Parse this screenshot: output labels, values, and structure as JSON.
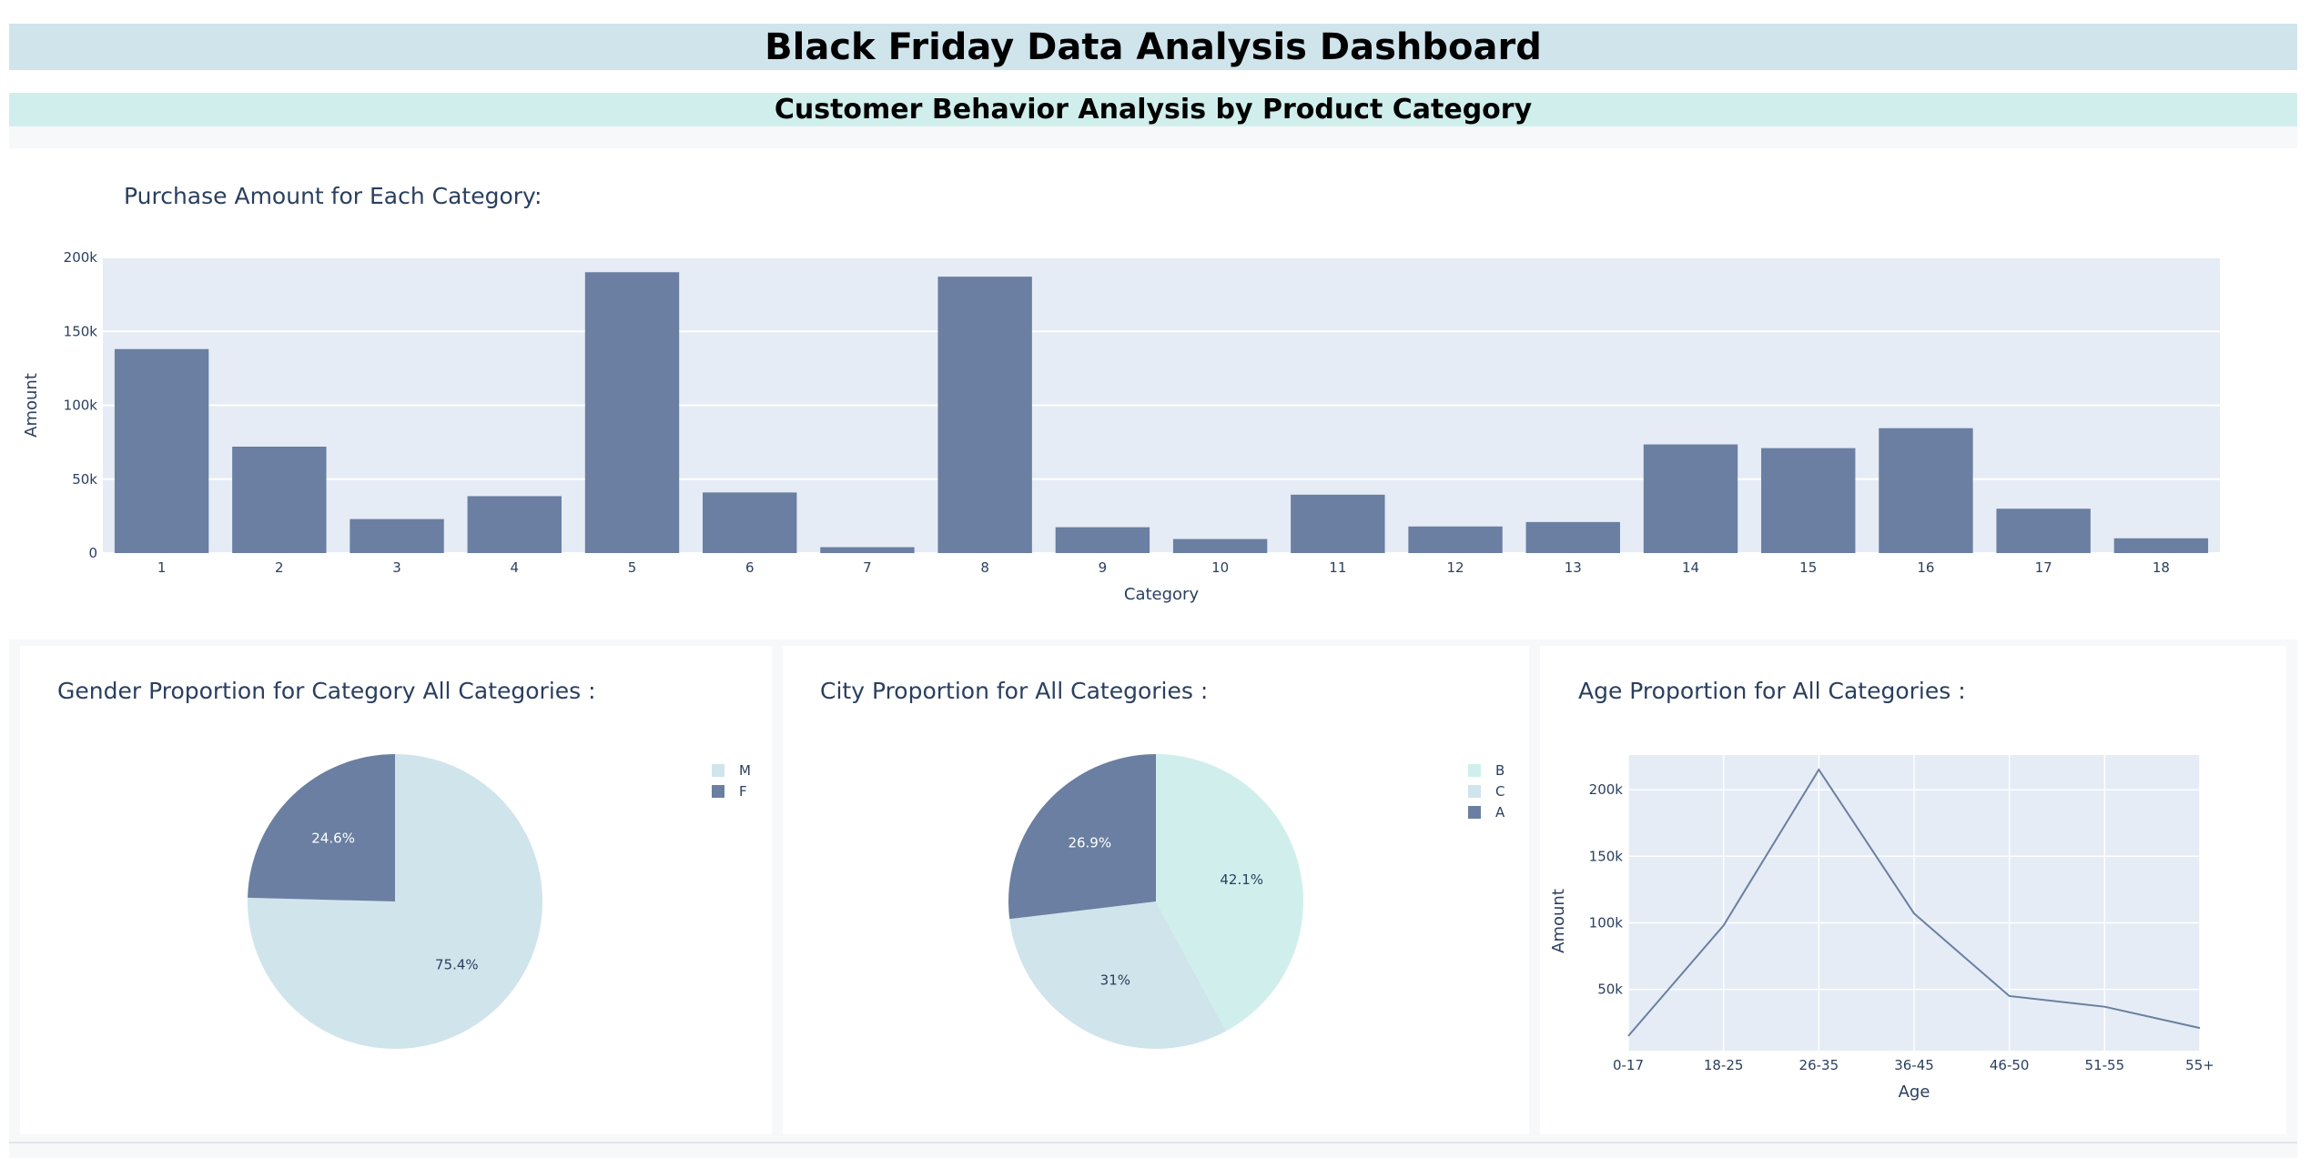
{
  "header": {
    "title": "Black Friday Data Analysis Dashboard",
    "subtitle": "Customer Behavior Analysis by Product Category"
  },
  "colors": {
    "title_banner": "#d0e4ec",
    "subtitle_banner": "#d0efec",
    "plot_bg": "#e5ecf6",
    "bar": "#6a7fa1",
    "gender_M": "#d0e4ec",
    "gender_F": "#6a7fa1",
    "city_B": "#d0efec",
    "city_C": "#d0e4ec",
    "city_A": "#6a7fa1",
    "line": "#6a7fa1"
  },
  "chart_data": [
    {
      "type": "bar",
      "title": "Purchase Amount for Each Category:",
      "xlabel": "Category",
      "ylabel": "Amount",
      "categories": [
        "1",
        "2",
        "3",
        "4",
        "5",
        "6",
        "7",
        "8",
        "9",
        "10",
        "11",
        "12",
        "13",
        "14",
        "15",
        "16",
        "17",
        "18"
      ],
      "values": [
        138000,
        72000,
        23000,
        38500,
        190000,
        41000,
        4000,
        187000,
        17500,
        9500,
        39500,
        18000,
        21000,
        73500,
        71000,
        84500,
        30000,
        10000
      ],
      "ylim": [
        0,
        200000
      ],
      "yticks": [
        0,
        50000,
        100000,
        150000,
        200000
      ],
      "ytick_labels": [
        "0",
        "50k",
        "100k",
        "150k",
        "200k"
      ],
      "grid": true
    },
    {
      "type": "pie",
      "title": "Gender Proportion for Category All Categories :",
      "labels": [
        "M",
        "F"
      ],
      "values": [
        75.4,
        24.6
      ],
      "value_labels": [
        "75.4%",
        "24.6%"
      ],
      "legend_position": "top-right"
    },
    {
      "type": "pie",
      "title": "City Proportion for All Categories :",
      "labels": [
        "B",
        "C",
        "A"
      ],
      "values": [
        42.1,
        31,
        26.9
      ],
      "value_labels": [
        "42.1%",
        "31%",
        "26.9%"
      ],
      "legend_position": "top-right"
    },
    {
      "type": "line",
      "title": "Age Proportion for All Categories :",
      "xlabel": "Age",
      "ylabel": "Amount",
      "categories": [
        "0-17",
        "18-25",
        "26-35",
        "36-45",
        "46-50",
        "51-55",
        "55+"
      ],
      "values": [
        15000,
        98000,
        215000,
        107000,
        45000,
        37000,
        21000
      ],
      "yticks": [
        50000,
        100000,
        150000,
        200000
      ],
      "ytick_labels": [
        "50k",
        "100k",
        "150k",
        "200k"
      ],
      "grid": true
    }
  ]
}
